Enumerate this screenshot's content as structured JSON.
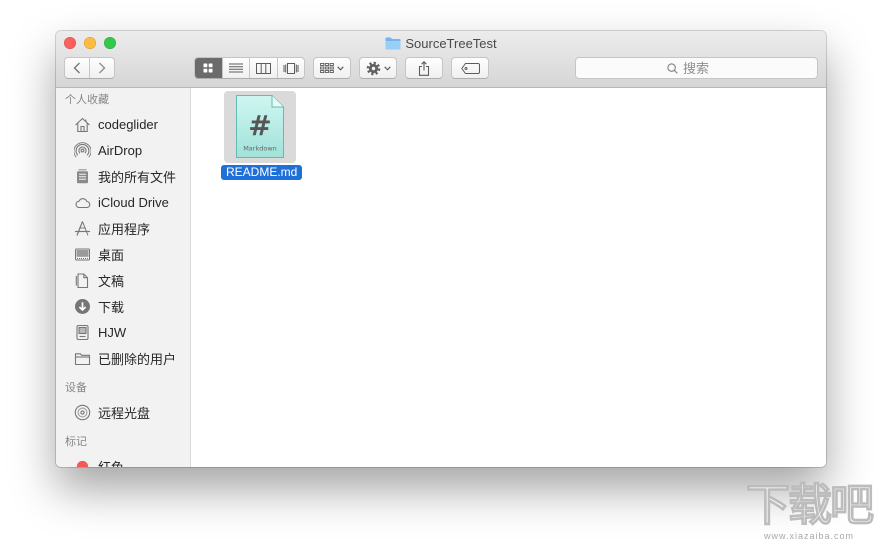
{
  "window": {
    "title": "SourceTreeTest",
    "title_icon": "folder-icon"
  },
  "colors": {
    "close": "#fc605c",
    "minimize": "#fdbc40",
    "zoom": "#34c84a",
    "folder_blue": "#6fb6ee",
    "selection": "#1f6fd9",
    "tag_red": "#f25a52",
    "selected_segment": "#6b6b6b"
  },
  "toolbar": {
    "navigation": [
      {
        "icon": "chevron-left-icon"
      },
      {
        "icon": "chevron-right-icon"
      }
    ],
    "view_modes": [
      {
        "icon": "icon-view-icon",
        "selected": true
      },
      {
        "icon": "list-view-icon",
        "selected": false
      },
      {
        "icon": "column-view-icon",
        "selected": false
      },
      {
        "icon": "cover-flow-icon",
        "selected": false
      }
    ],
    "buttons": [
      {
        "icon": "group-icon"
      },
      {
        "icon": "gear-icon"
      },
      {
        "icon": "share-icon"
      },
      {
        "icon": "tag-icon"
      }
    ],
    "search": {
      "placeholder": "搜索",
      "icon": "search-icon"
    }
  },
  "sidebar": {
    "sections": [
      {
        "header": "个人收藏",
        "items": [
          {
            "label": "codeglider",
            "icon": "home-icon"
          },
          {
            "label": "AirDrop",
            "icon": "airdrop-icon"
          },
          {
            "label": "我的所有文件",
            "icon": "all-files-icon"
          },
          {
            "label": "iCloud Drive",
            "icon": "cloud-icon"
          },
          {
            "label": "应用程序",
            "icon": "applications-icon"
          },
          {
            "label": "桌面",
            "icon": "desktop-icon"
          },
          {
            "label": "文稿",
            "icon": "documents-icon"
          },
          {
            "label": "下载",
            "icon": "downloads-icon"
          },
          {
            "label": "HJW",
            "icon": "drive-icon"
          },
          {
            "label": "已删除的用户",
            "icon": "folder-icon"
          }
        ]
      },
      {
        "header": "设备",
        "items": [
          {
            "label": "远程光盘",
            "icon": "disc-icon"
          }
        ]
      },
      {
        "header": "标记",
        "items": [
          {
            "label": "红色",
            "icon": "tag-dot-icon"
          }
        ]
      }
    ]
  },
  "content": {
    "files": [
      {
        "name": "README.md",
        "icon": "markdown-file-icon",
        "icon_symbol": "#",
        "icon_caption": "Markdown",
        "selected": true
      }
    ]
  },
  "watermark": {
    "text": "下载吧",
    "url": "www.xiazaiba.com"
  }
}
